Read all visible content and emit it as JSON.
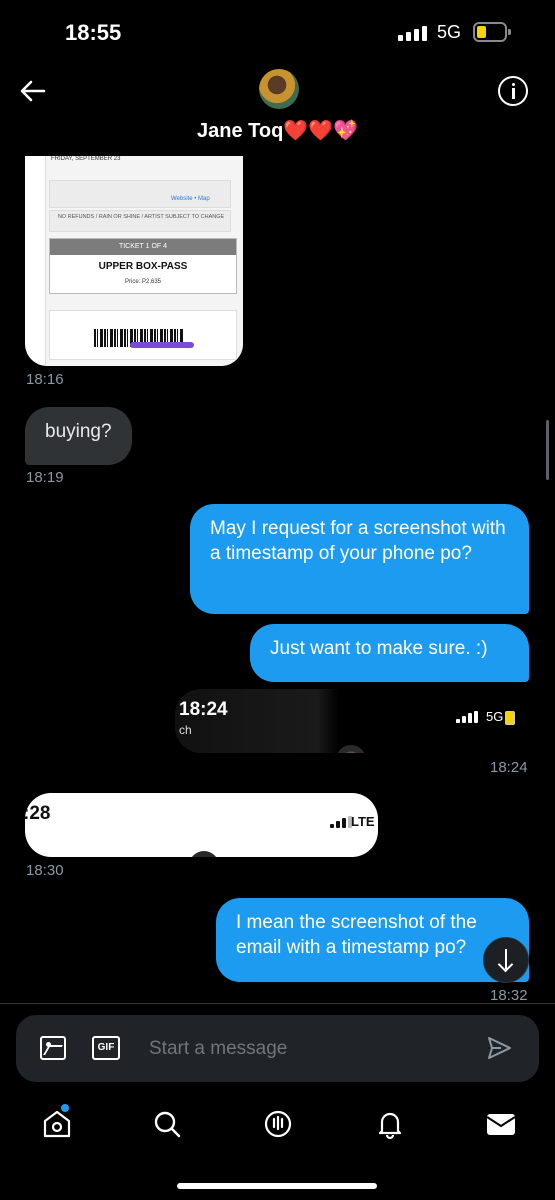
{
  "status_bar": {
    "time": "18:55",
    "network": "5G"
  },
  "header": {
    "contact_name": "Jane Toq",
    "name_emojis": "❤️❤️💖"
  },
  "ticket_image": {
    "date": "FRIDAY, SEPTEMBER 23",
    "website_link": "Website • Map",
    "notice": "NO REFUNDS / RAIN OR SHINE / ARTIST SUBJECT TO CHANGE",
    "ticket_header": "TICKET 1 OF 4",
    "pass_name": "UPPER BOX-PASS",
    "price": "Price: P2,635",
    "timestamp": "18:16"
  },
  "messages": [
    {
      "direction": "in",
      "text": "buying?",
      "timestamp": "18:19"
    },
    {
      "direction": "out",
      "text": "May I request for a screenshot with a timestamp of your phone po?"
    },
    {
      "direction": "out",
      "text": "Just want to make sure. :)"
    },
    {
      "direction": "out",
      "type": "image",
      "shot_time": "18:24",
      "shot_sub": "ch",
      "shot_network": "5G",
      "timestamp": "18:24"
    },
    {
      "direction": "in",
      "type": "image",
      "shot_time": ":28",
      "shot_network": "LTE",
      "timestamp": "18:30"
    },
    {
      "direction": "out",
      "text": "I mean the screenshot of the email with a timestamp po?",
      "timestamp": "18:32"
    }
  ],
  "composer": {
    "placeholder": "Start a message",
    "gif_label": "GIF"
  },
  "tabs": [
    "home",
    "search",
    "spaces",
    "notifications",
    "messages"
  ],
  "colors": {
    "accent": "#1d9bf0",
    "incoming_bubble": "#2f3336",
    "background": "#000000"
  }
}
